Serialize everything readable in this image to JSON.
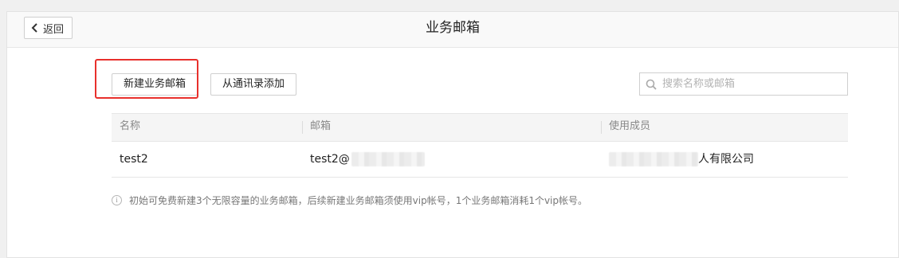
{
  "header": {
    "back_label": "返回",
    "title": "业务邮箱"
  },
  "toolbar": {
    "new_label": "新建业务邮箱",
    "import_label": "从通讯录添加",
    "highlight_color": "#e8302c"
  },
  "search": {
    "placeholder": "搜索名称或邮箱",
    "value": ""
  },
  "table": {
    "columns": [
      "名称",
      "邮箱",
      "使用成员"
    ],
    "rows": [
      {
        "name": "test2",
        "email_prefix": "test2@",
        "member_suffix": "人有限公司"
      }
    ]
  },
  "note": {
    "text": "初始可免费新建3个无限容量的业务邮箱，后续新建业务邮箱须使用vip帐号，1个业务邮箱消耗1个vip帐号。"
  },
  "icons": [
    "back-chevron-icon",
    "search-icon",
    "info-icon"
  ]
}
